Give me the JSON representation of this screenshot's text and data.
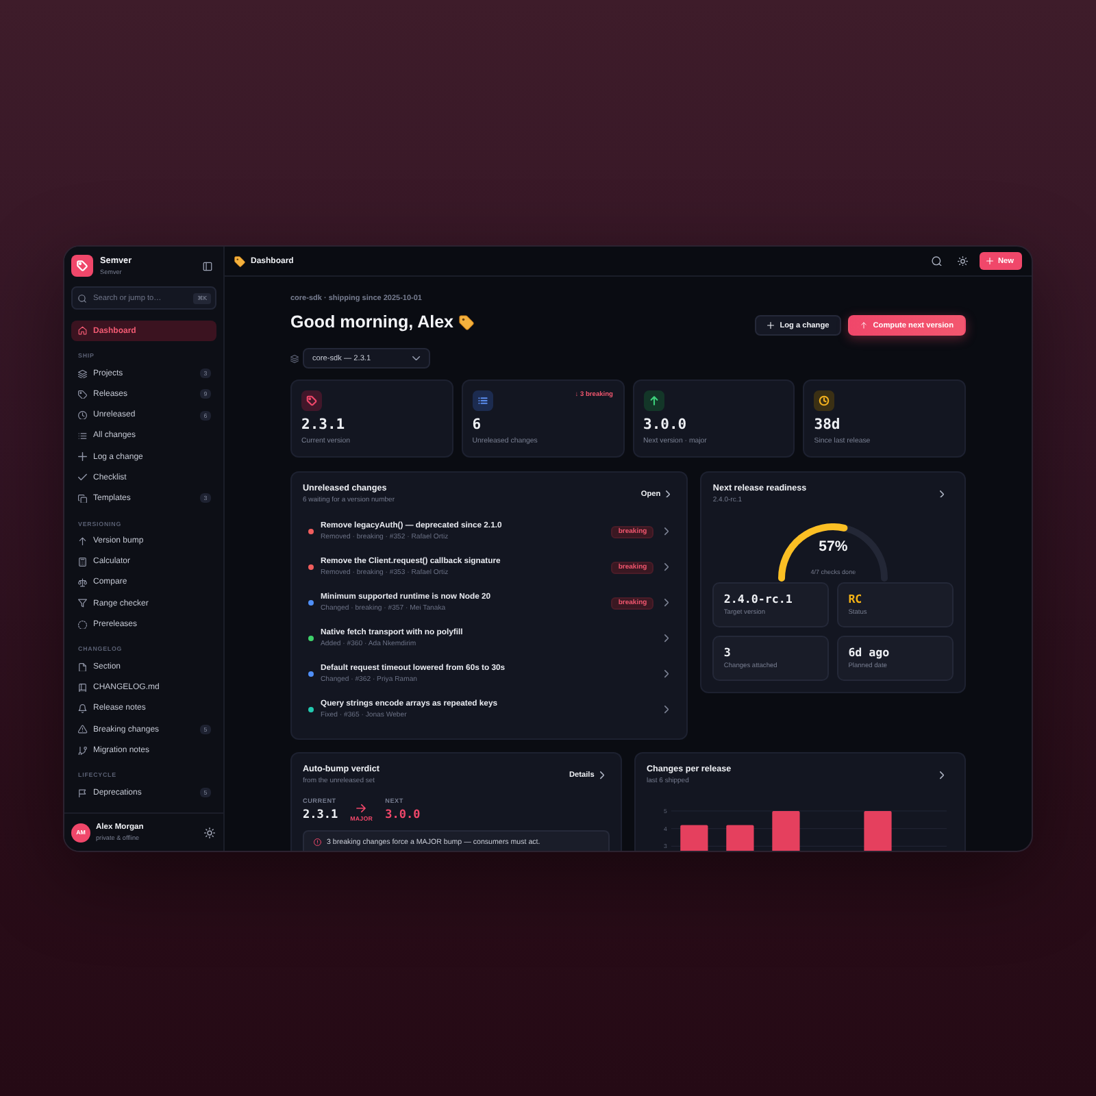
{
  "sidebar": {
    "brand": {
      "name": "Semver",
      "subtitle": "Semver"
    },
    "search": {
      "placeholder": "Search or jump to…",
      "shortcut": "⌘K"
    },
    "nav": [
      {
        "label": "Dashboard",
        "selected": true
      }
    ],
    "sections": [
      {
        "title": "SHIP",
        "items": [
          {
            "label": "Projects",
            "badge": "3",
            "selected": false
          },
          {
            "label": "Releases",
            "badge": "9",
            "selected": false
          },
          {
            "label": "Unreleased",
            "badge": "6",
            "selected": false
          },
          {
            "label": "All changes",
            "selected": false
          },
          {
            "label": "Log a change",
            "selected": false
          },
          {
            "label": "Checklist",
            "selected": false
          },
          {
            "label": "Templates",
            "badge": "3",
            "selected": false
          }
        ]
      },
      {
        "title": "VERSIONING",
        "items": [
          {
            "label": "Version bump",
            "selected": false
          },
          {
            "label": "Calculator",
            "selected": false
          },
          {
            "label": "Compare",
            "selected": false
          },
          {
            "label": "Range checker",
            "selected": false
          },
          {
            "label": "Prereleases",
            "selected": false
          }
        ]
      },
      {
        "title": "CHANGELOG",
        "items": [
          {
            "label": "Section",
            "selected": false
          },
          {
            "label": "CHANGELOG.md",
            "selected": false
          },
          {
            "label": "Release notes",
            "selected": false
          },
          {
            "label": "Breaking changes",
            "badge": "5",
            "selected": false
          },
          {
            "label": "Migration notes",
            "selected": false
          }
        ]
      },
      {
        "title": "LIFECYCLE",
        "items": [
          {
            "label": "Deprecations",
            "badge": "5",
            "selected": false
          }
        ]
      }
    ],
    "user": {
      "initials": "AM",
      "name": "Alex Morgan",
      "status": "private & offline"
    }
  },
  "topbar": {
    "title": "Dashboard",
    "new_button": "New"
  },
  "header": {
    "eyebrow": "core-sdk · shipping since 2025-10-01",
    "greeting": "Good morning, Alex",
    "actions": [
      {
        "label": "Log a change",
        "kind": "secondary"
      },
      {
        "label": "Compute next version",
        "kind": "primary"
      }
    ],
    "project_select": {
      "value": "core-sdk — 2.3.1"
    }
  },
  "stats": [
    {
      "value": "2.3.1",
      "label": "Current version"
    },
    {
      "value": "6",
      "label": "Unreleased changes",
      "note": "↓ 3 breaking"
    },
    {
      "value": "3.0.0",
      "label": "Next version · major"
    },
    {
      "value": "38d",
      "label": "Since last release"
    }
  ],
  "unreleased": {
    "title": "Unreleased changes",
    "subtitle": "6 waiting for a version number",
    "action": "Open",
    "items": [
      {
        "title": "Remove legacyAuth() — deprecated since 2.1.0",
        "meta": "Removed · breaking · #352 · Rafael Ortiz",
        "color": "#f05d5d",
        "badge": "breaking"
      },
      {
        "title": "Remove the Client.request() callback signature",
        "meta": "Removed · breaking · #353 · Rafael Ortiz",
        "color": "#f05d5d",
        "badge": "breaking"
      },
      {
        "title": "Minimum supported runtime is now Node 20",
        "meta": "Changed · breaking · #357 · Mei Tanaka",
        "color": "#4f8ff7",
        "badge": "breaking"
      },
      {
        "title": "Native fetch transport with no polyfill",
        "meta": "Added · #360 · Ada Nkemdirim",
        "color": "#3ed16b"
      },
      {
        "title": "Default request timeout lowered from 60s to 30s",
        "meta": "Changed · #362 · Priya Raman",
        "color": "#4f8ff7"
      },
      {
        "title": "Query strings encode arrays as repeated keys",
        "meta": "Fixed · #365 · Jonas Weber",
        "color": "#22c9b0"
      }
    ]
  },
  "readiness": {
    "title": "Next release readiness",
    "subtitle": "2.4.0-rc.1",
    "gauge": {
      "level": 0.57,
      "reading": "57%",
      "caption": "4/7 checks done"
    },
    "facts": [
      {
        "value": "2.4.0-rc.1",
        "label": "Target version"
      },
      {
        "value": "RC",
        "label": "Status",
        "color": "#f5b316"
      },
      {
        "value": "3",
        "label": "Changes attached"
      },
      {
        "value": "6d ago",
        "label": "Planned date"
      }
    ]
  },
  "verdict": {
    "title": "Auto-bump verdict",
    "subtitle": "from the unreleased set",
    "action": "Details",
    "current": {
      "label": "CURRENT",
      "value": "2.3.1"
    },
    "bump": "MAJOR",
    "next": {
      "label": "NEXT",
      "value": "3.0.0"
    },
    "alert": "3 breaking changes force a MAJOR bump — consumers must act."
  },
  "release_chart": {
    "title": "Changes per release",
    "subtitle": "last 6 shipped",
    "chart_data": {
      "type": "bar",
      "values": [
        4.2,
        4.2,
        5,
        null,
        5,
        null
      ],
      "ylim": [
        2.6,
        5
      ],
      "yticks": [
        3,
        4,
        5
      ]
    }
  }
}
